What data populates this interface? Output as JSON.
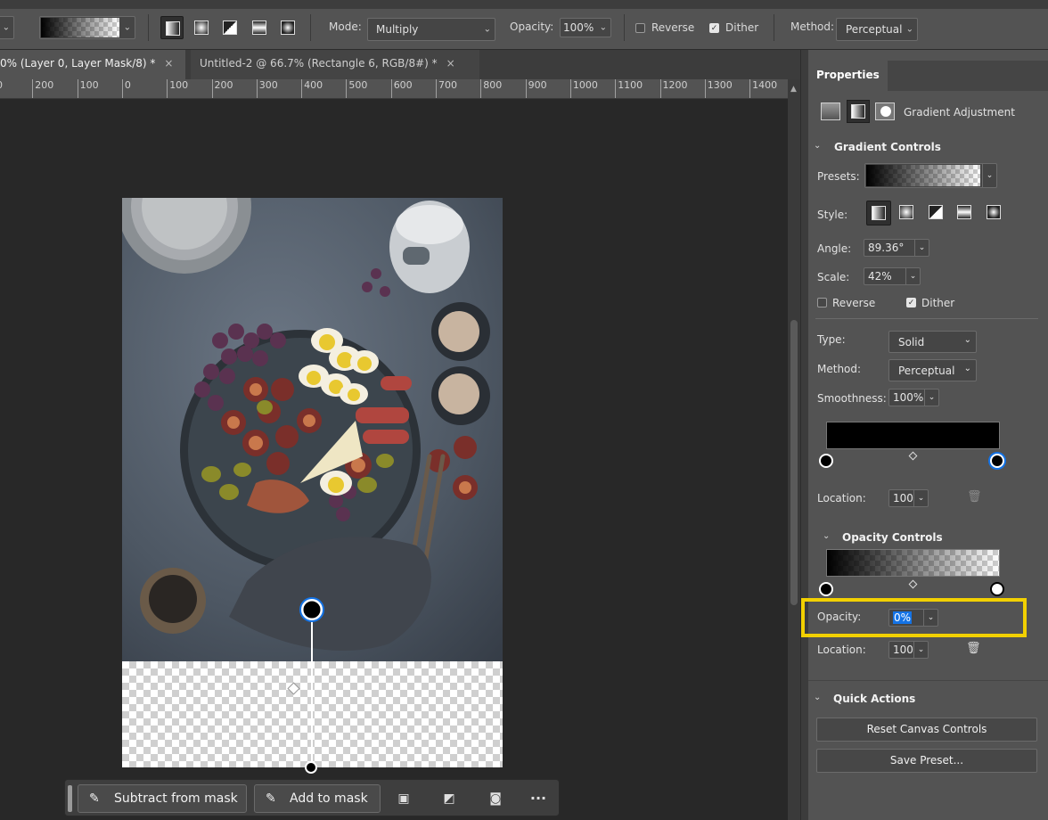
{
  "options_bar": {
    "mode_label": "Mode:",
    "mode_value": "Multiply",
    "opacity_label": "Opacity:",
    "opacity_value": "100%",
    "reverse_label": "Reverse",
    "reverse_checked": false,
    "dither_label": "Dither",
    "dither_checked": true,
    "method_label": "Method:",
    "method_value": "Perceptual",
    "style_icons": [
      "linear-gradient-icon",
      "radial-gradient-icon",
      "angle-gradient-icon",
      "reflected-gradient-icon",
      "diamond-gradient-icon"
    ]
  },
  "tabs": [
    {
      "label": "0% (Layer 0, Layer Mask/8) *",
      "close": "×",
      "active": true
    },
    {
      "label": "Untitled-2 @ 66.7% (Rectangle 6, RGB/8#) *",
      "close": "×",
      "active": false
    }
  ],
  "ruler": {
    "ticks": [
      "00",
      "200",
      "100",
      "0",
      "100",
      "200",
      "300",
      "400",
      "500",
      "600",
      "700",
      "800",
      "900",
      "1000",
      "1100",
      "1200",
      "1300",
      "1400"
    ]
  },
  "taskbar": {
    "subtract_label": "Subtract from mask",
    "add_label": "Add to mask",
    "more_label": "···"
  },
  "properties": {
    "tab_label": "Properties",
    "header_label": "Gradient Adjustment",
    "gradient_controls": {
      "title": "Gradient Controls",
      "presets_label": "Presets:",
      "style_label": "Style:",
      "angle_label": "Angle:",
      "angle_value": "89.36°",
      "scale_label": "Scale:",
      "scale_value": "42%",
      "reverse_label": "Reverse",
      "reverse_checked": false,
      "dither_label": "Dither",
      "dither_checked": true,
      "type_label": "Type:",
      "type_value": "Solid",
      "method_label": "Method:",
      "method_value": "Perceptual",
      "smoothness_label": "Smoothness:",
      "smoothness_value": "100%",
      "location_label": "Location:",
      "location_value": "100"
    },
    "opacity_controls": {
      "title": "Opacity Controls",
      "opacity_label": "Opacity:",
      "opacity_value": "0%",
      "location_label": "Location:",
      "location_value": "100"
    },
    "quick_actions": {
      "title": "Quick Actions",
      "reset_label": "Reset Canvas Controls",
      "save_label": "Save Preset..."
    }
  },
  "colors": {
    "highlight": "#f2d000",
    "accent": "#1473e6"
  }
}
